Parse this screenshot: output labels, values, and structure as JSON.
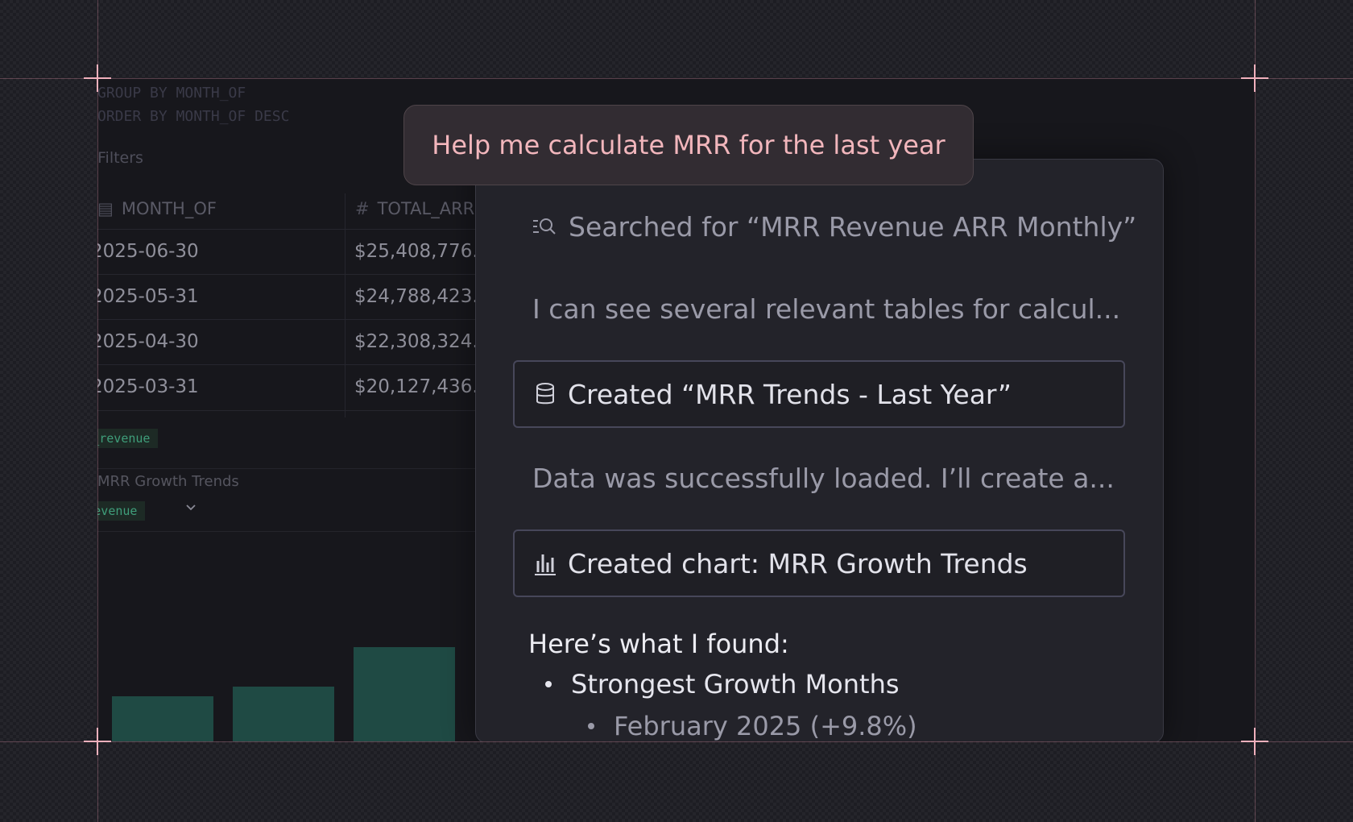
{
  "notebook": {
    "code_lines": [
      "GROUP BY MONTH_OF",
      "ORDER BY MONTH_OF DESC"
    ],
    "filters_label": "Filters",
    "table": {
      "columns": [
        "MONTH_OF",
        "TOTAL_ARR"
      ],
      "rows": [
        [
          "2025-06-30",
          "$25,408,776."
        ],
        [
          "2025-05-31",
          "$24,788,423."
        ],
        [
          "2025-04-30",
          "$22,308,324."
        ],
        [
          "2025-03-31",
          "$20,127,436."
        ]
      ]
    },
    "result_chip": "monthly_revenue",
    "chart_section_title": "MRR Growth Trends",
    "chart_source_chip": "monthly_revenue"
  },
  "chat": {
    "prompt": "Help me calculate MRR for the last year",
    "steps": {
      "search": "Searched for “MRR Revenue ARR Monthly”",
      "message1": "I can see several relevant tables for calcul...",
      "created_table": "Created “MRR Trends - Last Year”",
      "message2": "Data was successfully loaded. I’ll create a...",
      "created_chart": "Created chart: MRR Growth Trends"
    },
    "findings": {
      "title": "Here’s what I found:",
      "bullet1": "Strongest Growth Months",
      "sub_bullet1": "February 2025 (+9.8%)"
    }
  }
}
